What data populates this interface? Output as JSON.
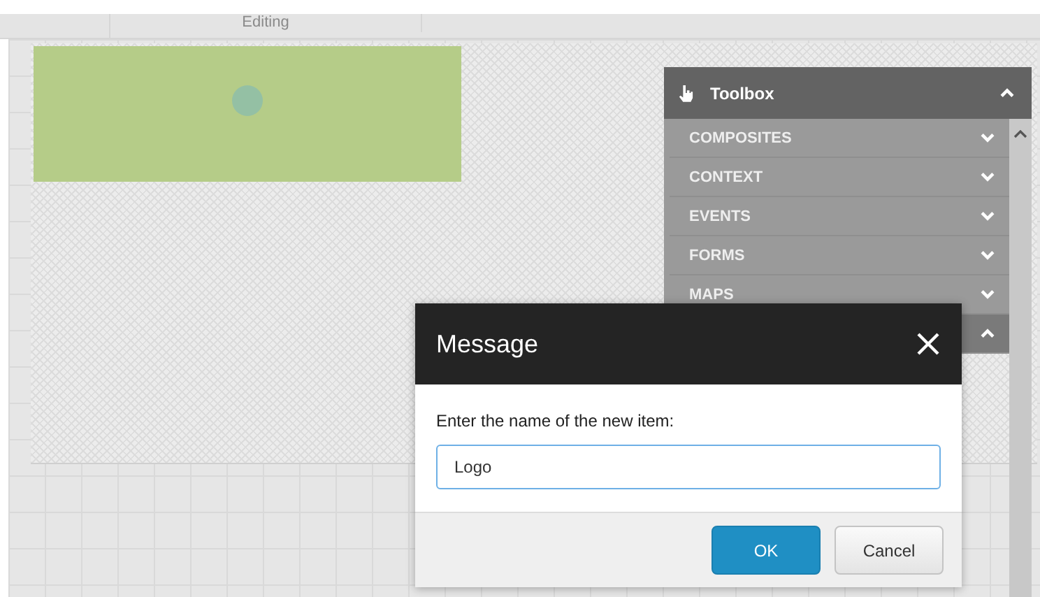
{
  "tabs": [
    {
      "label": "Editing",
      "selected": true
    }
  ],
  "toolbox": {
    "title": "Toolbox",
    "expanded": true,
    "sections": [
      {
        "label": "COMPOSITES",
        "expanded": false
      },
      {
        "label": "CONTEXT",
        "expanded": false
      },
      {
        "label": "EVENTS",
        "expanded": false
      },
      {
        "label": "FORMS",
        "expanded": false
      },
      {
        "label": "MAPS",
        "expanded": false
      },
      {
        "expanded": true
      }
    ]
  },
  "dialog": {
    "title": "Message",
    "prompt": "Enter the name of the new item:",
    "field": {
      "value": "Logo",
      "focused": true
    },
    "buttons": [
      {
        "label": "OK",
        "kind": "primary"
      },
      {
        "label": "Cancel",
        "kind": "default"
      }
    ]
  }
}
